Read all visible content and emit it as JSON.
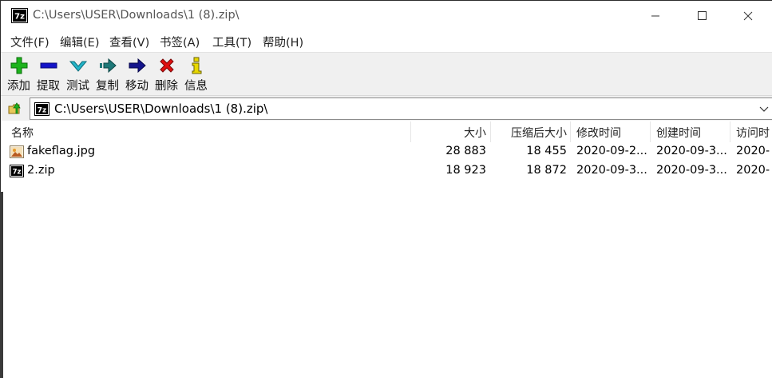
{
  "window": {
    "title": "C:\\Users\\USER\\Downloads\\1 (8).zip\\",
    "app_icon": "7z-icon"
  },
  "menu": [
    "文件(F)",
    "编辑(E)",
    "查看(V)",
    "书签(A)",
    "工具(T)",
    "帮助(H)"
  ],
  "toolbar": {
    "add": "添加",
    "extract": "提取",
    "test": "测试",
    "copy": "复制",
    "move": "移动",
    "delete": "删除",
    "info": "信息"
  },
  "address": {
    "path": "C:\\Users\\USER\\Downloads\\1 (8).zip\\"
  },
  "columns": {
    "name": "名称",
    "size": "大小",
    "packed": "压缩后大小",
    "modified": "修改时间",
    "created": "创建时间",
    "accessed": "访问时"
  },
  "files": [
    {
      "name": "fakeflag.jpg",
      "icon": "image-file-icon",
      "size": "28 883",
      "packed": "18 455",
      "modified": "2020-09-2...",
      "created": "2020-09-3...",
      "accessed": "2020-"
    },
    {
      "name": "2.zip",
      "icon": "7z-archive-icon",
      "size": "18 923",
      "packed": "18 872",
      "modified": "2020-09-3...",
      "created": "2020-09-3...",
      "accessed": "2020-"
    }
  ],
  "colors": {
    "toolbar_bg": "#f0f0f0",
    "add_green": "#1db31d",
    "extract_blue": "#1414c8",
    "test_cyan": "#22b4c8",
    "copy_teal": "#1e7878",
    "move_navy": "#14148c",
    "delete_red": "#e01010",
    "info_yellow": "#e8d800"
  }
}
